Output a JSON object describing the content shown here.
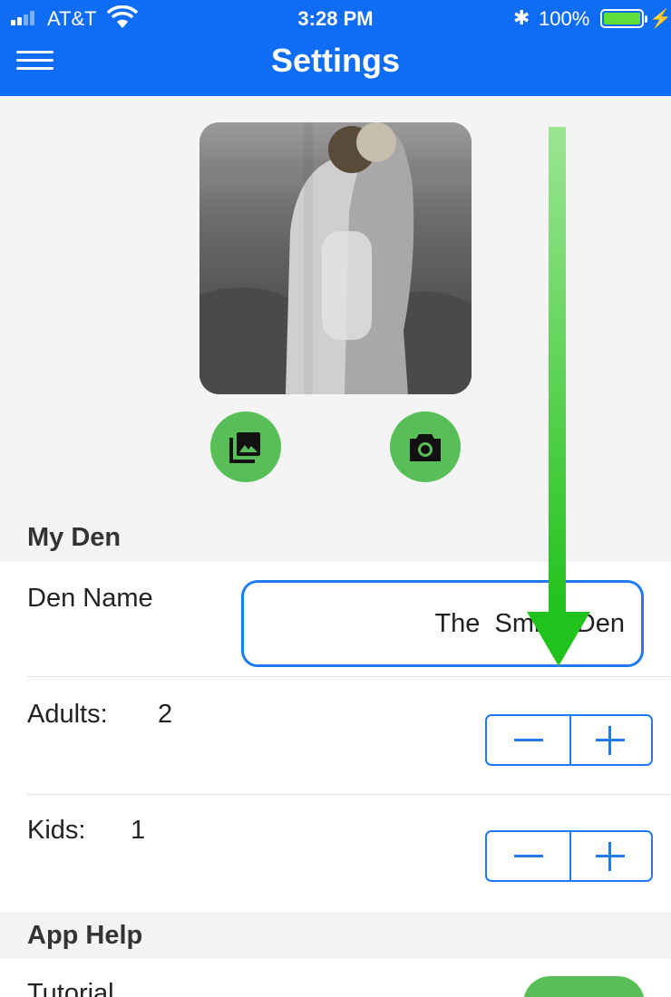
{
  "status_bar": {
    "carrier": "AT&T",
    "time": "3:28 PM",
    "bluetooth_icon": "bluetooth-icon",
    "battery": "100%",
    "battery_fill_color": "#5fdd3a"
  },
  "header": {
    "title": "Settings",
    "menu_icon": "hamburger-menu-icon",
    "background": "#0f6cf5"
  },
  "photo": {
    "gallery_icon": "photo-library-icon",
    "camera_icon": "camera-icon",
    "button_color": "#58bf58"
  },
  "my_den": {
    "header": "My Den",
    "den_name_label": "Den Name",
    "den_name_value": "The  Smith  Den",
    "adults_label": "Adults:",
    "adults_value": "2",
    "kids_label": "Kids:",
    "kids_value": "1",
    "stepper_color": "#1f7bf2"
  },
  "app_help": {
    "header": "App Help",
    "tutorial_label": "Tutorial",
    "toggle_color": "#58bf58"
  },
  "overlay": {
    "arrow_icon": "down-arrow-icon",
    "arrow_color": "#22c21c"
  }
}
